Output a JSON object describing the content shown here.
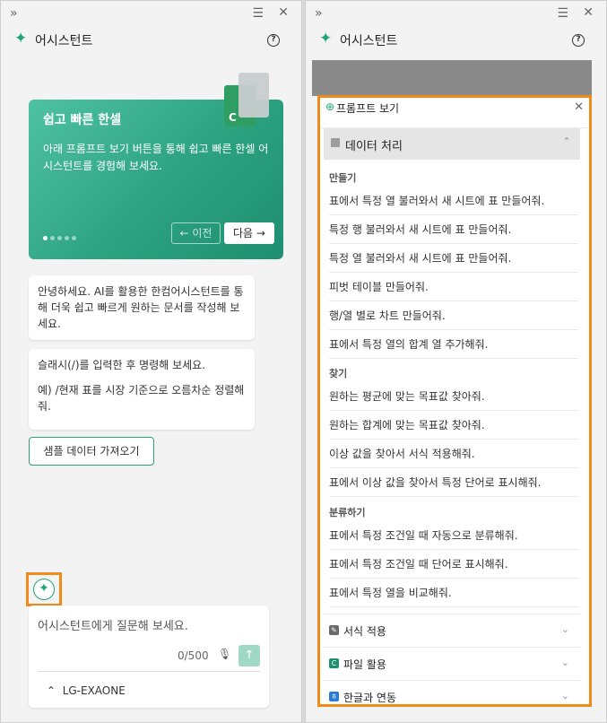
{
  "left": {
    "title": "어시스턴트",
    "card": {
      "title": "쉽고 빠른 한셀",
      "desc": "아래 프롬프트 보기 버튼을 통해 쉽고 빠른 한셀 어시스턴트를 경험해 보세요.",
      "prev": "← 이전",
      "next": "다음 →",
      "page": 1,
      "pages": 5
    },
    "bubble1": "안녕하세요. AI를 활용한 한컴어시스턴트를 통해 더욱 쉽고 빠르게 원하는 문서를 작성해 보세요.",
    "bubble2_a": "슬래시(/)를 입력한 후 명령해 보세요.",
    "bubble2_b": "예) /현재 표를 시장 기준으로 오름차순 정렬해줘.",
    "sample_button": "샘플 데이터 가져오기",
    "input_placeholder": "어시스턴트에게 질문해 보세요.",
    "char_count": "0/500",
    "model": "LG-EXAONE"
  },
  "right": {
    "title": "어시스턴트",
    "prompt_title": "프롬프트 보기",
    "section": "데이터 처리",
    "groups": {
      "make": "만들기",
      "find": "찾기",
      "classify": "분류하기"
    },
    "make_items": [
      "표에서 특정 열 불러와서 새 시트에 표 만들어줘.",
      "특정 행 불러와서 새 시트에 표 만들어줘.",
      "특정 열 불러와서 새 시트에 표 만들어줘.",
      "피벗 테이블 만들어줘.",
      "행/열 별로 차트 만들어줘.",
      "표에서 특정 열의 합계 열 추가해줘."
    ],
    "find_items": [
      "원하는 평균에 맞는 목표값 찾아줘.",
      "원하는 합계에 맞는 목표값 찾아줘.",
      "이상 값을 찾아서 서식 적용해줘.",
      "표에서 이상 값을 찾아서 특정 단어로 표시해줘."
    ],
    "classify_items": [
      "표에서 특정 조건일 때 자동으로 분류해줘.",
      "표에서 특정 조건일 때 단어로 표시해줘.",
      "표에서 특정 열을 비교해줘."
    ],
    "collapsed": [
      "서식 적용",
      "파일 활용",
      "한글과 연동"
    ]
  },
  "colors": {
    "accent": "#1fa47a",
    "highlight": "#f08a1b"
  }
}
